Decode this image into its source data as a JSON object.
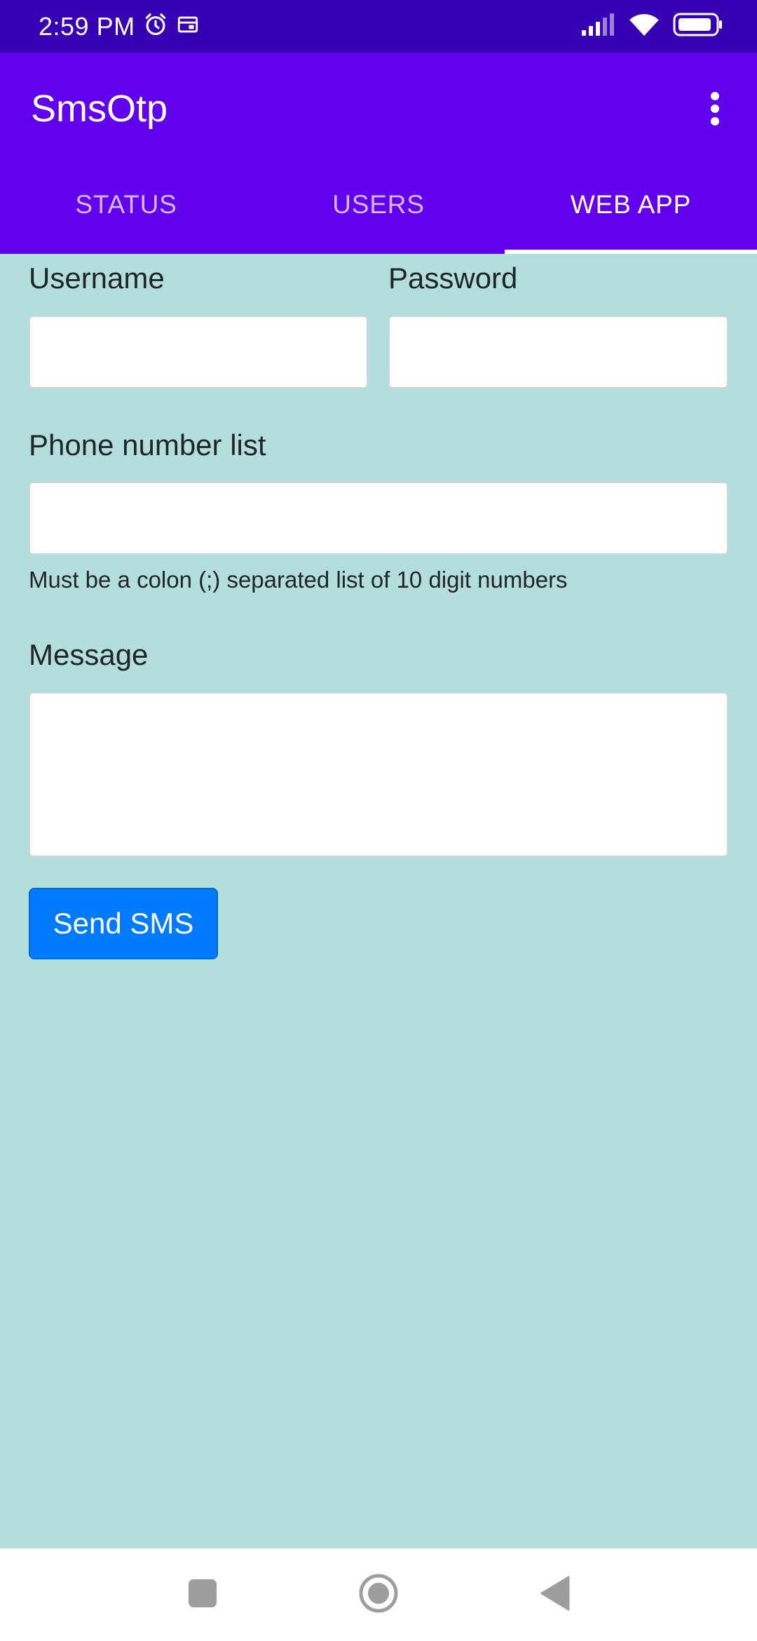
{
  "status_bar": {
    "time": "2:59 PM",
    "icons": [
      "alarm-icon",
      "screen-cast-icon",
      "signal-icon",
      "wifi-icon",
      "battery-icon"
    ]
  },
  "app_bar": {
    "title": "SmsOtp",
    "menu_icon": "more-vert-icon",
    "tabs": [
      {
        "label": "STATUS",
        "active": false
      },
      {
        "label": "USERS",
        "active": false
      },
      {
        "label": "WEB APP",
        "active": true
      }
    ]
  },
  "form": {
    "username_label": "Username",
    "username_value": "",
    "password_label": "Password",
    "password_value": "",
    "phone_label": "Phone number list",
    "phone_value": "",
    "phone_help": "Must be a colon (;) separated list of 10 digit numbers",
    "message_label": "Message",
    "message_value": "",
    "send_label": "Send SMS"
  },
  "nav_bar": {
    "icons": [
      "recents-square-icon",
      "home-circle-icon",
      "back-triangle-icon"
    ]
  },
  "colors": {
    "status_bar": "#3700b3",
    "app_bar": "#6200ee",
    "background": "#b2dfdb",
    "button": "#007bff"
  }
}
